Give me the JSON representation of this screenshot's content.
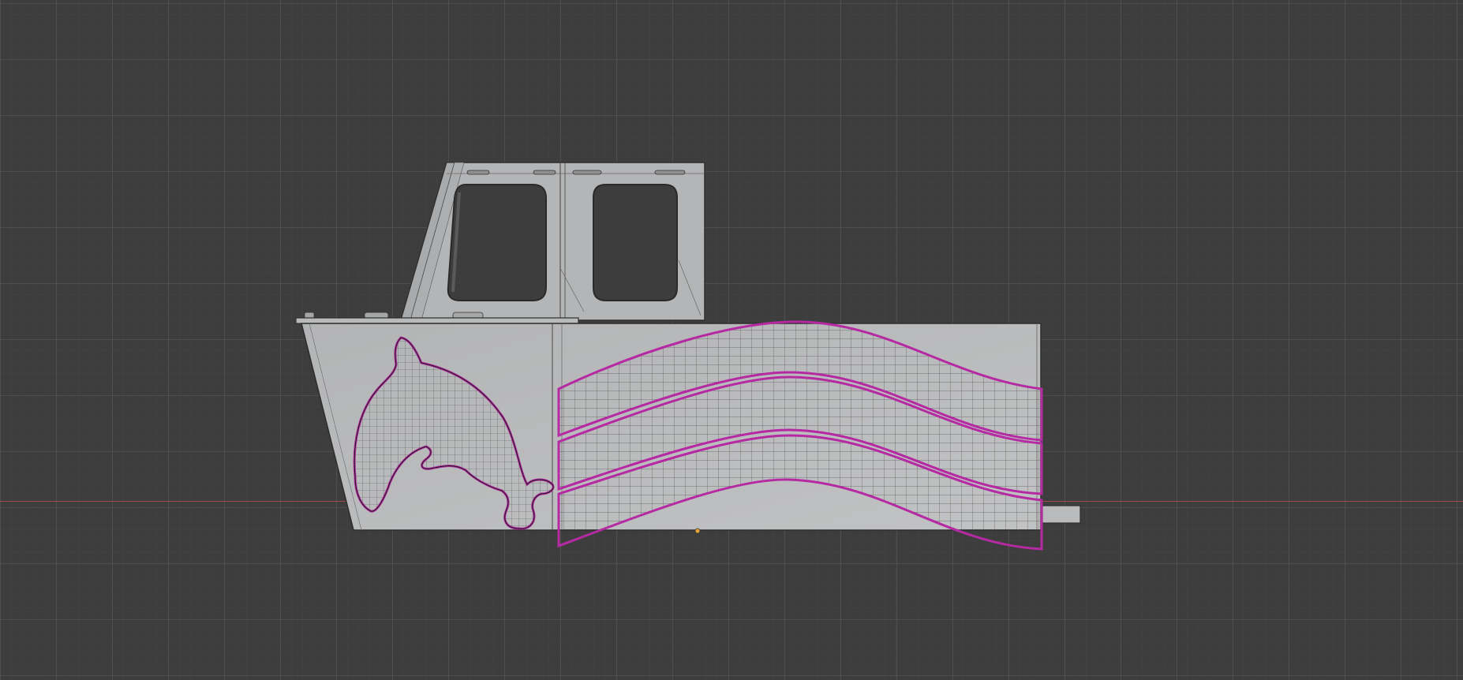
{
  "viewport": {
    "background": "#3d3d3d",
    "x_axis_color": "#a0484a",
    "mesh_color": "#b8b9ba",
    "mesh_edge_color": "#2e2e2e",
    "selection_color": "#b52aa2",
    "origin_color": "#e8a23a"
  },
  "objects": {
    "boat_hull": "boat-hull",
    "cabin": "cabin",
    "dolphin": "dolphin-decal",
    "wave_stripes": "wave-stripes",
    "propeller_shaft": "propeller-shaft"
  }
}
